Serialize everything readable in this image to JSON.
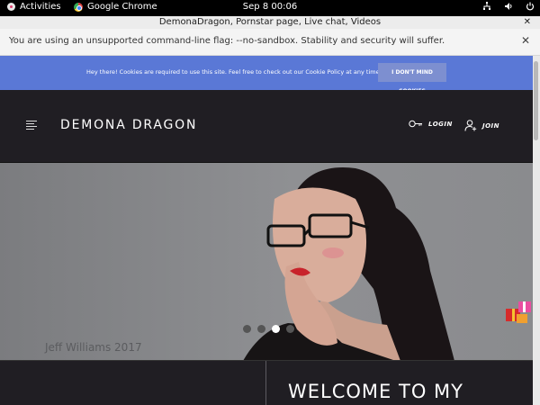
{
  "topbar": {
    "activities": "Activities",
    "app_name": "Google Chrome",
    "clock": "Sep 8  00:06"
  },
  "window": {
    "title": "DemonaDragon, Pornstar page, Live chat, Videos",
    "close_glyph": "✕"
  },
  "infobar": {
    "message": "You are using an unsupported command-line flag: --no-sandbox. Stability and security will suffer.",
    "close_glyph": "✕"
  },
  "cookie_banner": {
    "text": "Hey there! Cookies are required to use this site. Feel free to check out our Cookie Policy at any time.",
    "button": "I DON'T MIND COOKIES",
    "background": "#5a78d6"
  },
  "header": {
    "brand": "DEMONA DRAGON",
    "login": "LOGIN",
    "join": "JOIN"
  },
  "hero": {
    "photo_credit": "Jeff Williams 2017",
    "slides": 4,
    "active_slide": 3
  },
  "content": {
    "heading": "WELCOME TO MY"
  },
  "icons": {
    "menu": "hamburger-icon",
    "login": "key-icon",
    "join": "add-user-icon",
    "gift": "gift-icon",
    "network": "network-icon",
    "volume": "volume-icon",
    "power": "power-icon"
  }
}
